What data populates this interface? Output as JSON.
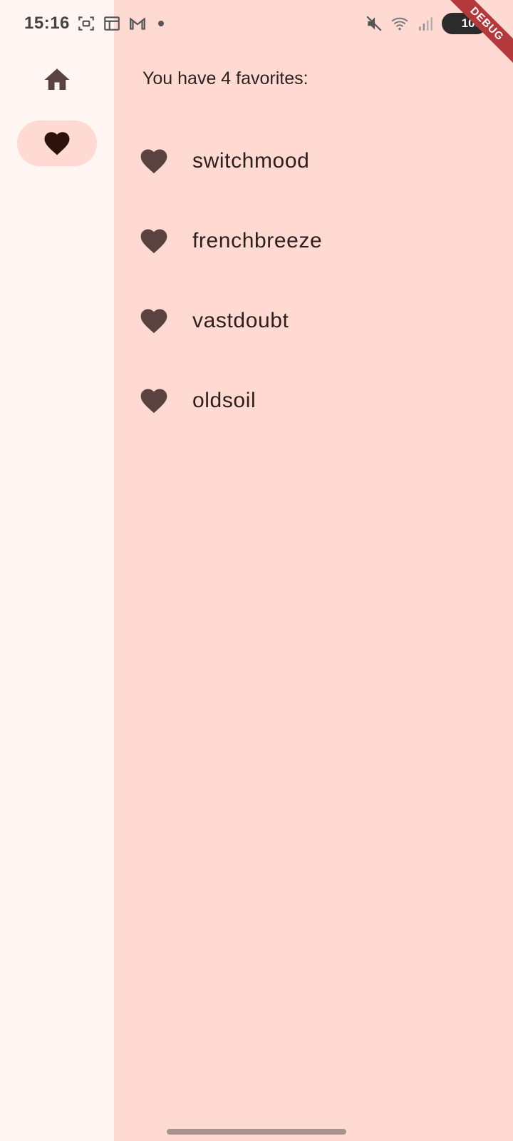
{
  "status_bar": {
    "time": "15:16",
    "left_icons": [
      "screenshot-icon",
      "calendar-icon",
      "gmail-icon",
      "notification-dot-icon"
    ],
    "right_icons": [
      "mute-icon",
      "wifi-icon",
      "signal-icon"
    ],
    "battery_level": "100"
  },
  "debug_banner": {
    "label": "DEBUG"
  },
  "nav_rail": {
    "items": [
      {
        "name": "Home",
        "icon": "home-icon",
        "selected": false
      },
      {
        "name": "Favorites",
        "icon": "heart-icon",
        "selected": true
      }
    ]
  },
  "main": {
    "header": "You have 4 favorites:",
    "favorites": [
      {
        "label": "switchmood",
        "icon": "heart-icon"
      },
      {
        "label": "frenchbreeze",
        "icon": "heart-icon"
      },
      {
        "label": "vastdoubt",
        "icon": "heart-icon"
      },
      {
        "label": "oldsoil",
        "icon": "heart-icon"
      }
    ]
  },
  "colors": {
    "rail_background": "#fff5f3",
    "main_background": "#ffdad3",
    "selected_indicator": "#ffdad2",
    "icon_color": "#5a433f",
    "text_color": "#2d1f1c",
    "debug_banner": "#b3393d"
  }
}
